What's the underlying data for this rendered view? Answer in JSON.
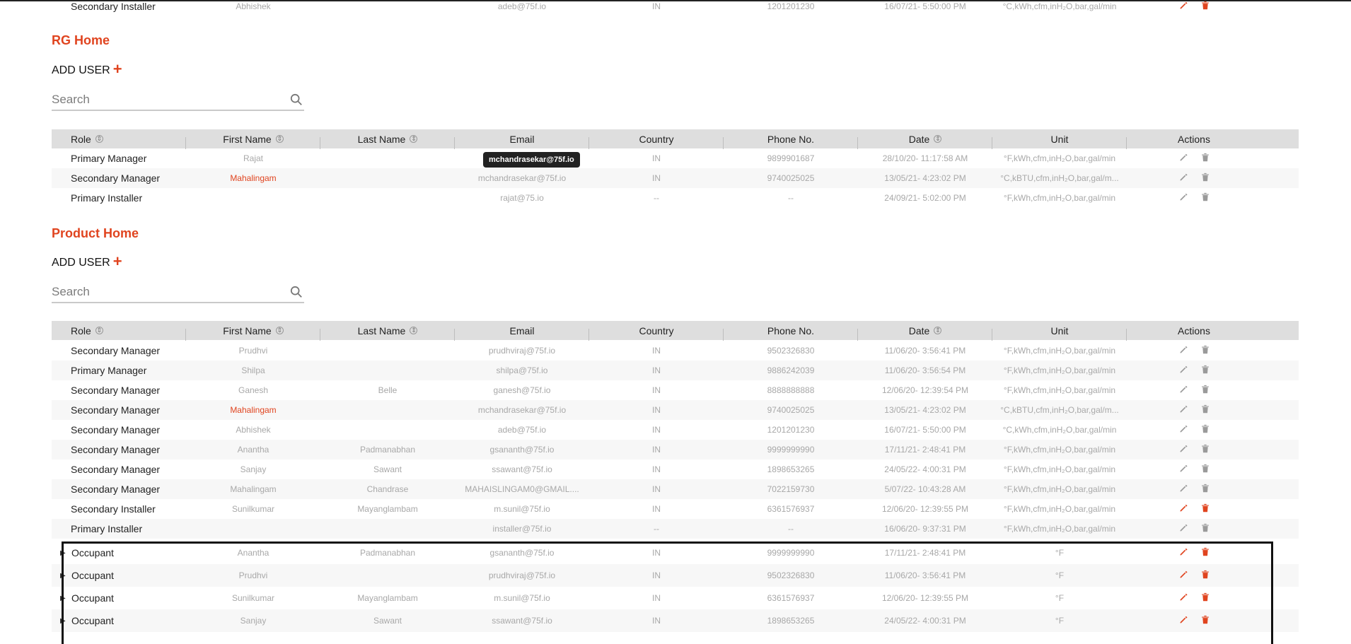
{
  "top_row": {
    "role": "Secondary Installer",
    "first_name": "Abhishek",
    "last_name": "",
    "email": "adeb@75f.io",
    "country": "IN",
    "phone": "1201201230",
    "date": "16/07/21- 5:50:00 PM",
    "unit": "°C,kWh,cfm,inH₂O,bar,gal/min",
    "active": true
  },
  "columns": {
    "role": "Role",
    "first_name": "First Name",
    "last_name": "Last Name",
    "email": "Email",
    "country": "Country",
    "phone": "Phone No.",
    "date": "Date",
    "unit": "Unit",
    "actions": "Actions"
  },
  "rg_home": {
    "title": "RG Home",
    "add_user": "ADD USER",
    "search_placeholder": "Search",
    "tooltip": "mchandrasekar@75f.io",
    "rows": [
      {
        "role": "Primary Manager",
        "first_name": "Rajat",
        "last_name": "",
        "email": "",
        "country": "IN",
        "phone": "9899901687",
        "date": "28/10/20- 11:17:58 AM",
        "unit": "°F,kWh,cfm,inH₂O,bar,gal/min"
      },
      {
        "role": "Secondary Manager",
        "first_name": "Mahalingam",
        "last_name": "",
        "email": "mchandrasekar@75f.io",
        "country": "IN",
        "phone": "9740025025",
        "date": "13/05/21- 4:23:02 PM",
        "unit": "°C,kBTU,cfm,inH₂O,bar,gal/m..."
      },
      {
        "role": "Primary Installer",
        "first_name": "",
        "last_name": "",
        "email": "rajat@75.io",
        "country": "--",
        "phone": "--",
        "date": "24/09/21- 5:02:00 PM",
        "unit": "°F,kWh,cfm,inH₂O,bar,gal/min"
      }
    ]
  },
  "product_home": {
    "title": "Product Home",
    "add_user": "ADD USER",
    "search_placeholder": "Search",
    "rows": [
      {
        "role": "Secondary Manager",
        "first_name": "Prudhvi",
        "last_name": "",
        "email": "prudhviraj@75f.io",
        "country": "IN",
        "phone": "9502326830",
        "date": "11/06/20- 3:56:41 PM",
        "unit": "°F,kWh,cfm,inH₂O,bar,gal/min"
      },
      {
        "role": "Primary Manager",
        "first_name": "Shilpa",
        "last_name": "",
        "email": "shilpa@75f.io",
        "country": "IN",
        "phone": "9886242039",
        "date": "11/06/20- 3:56:54 PM",
        "unit": "°F,kWh,cfm,inH₂O,bar,gal/min"
      },
      {
        "role": "Secondary Manager",
        "first_name": "Ganesh",
        "last_name": "Belle",
        "email": "ganesh@75f.io",
        "country": "IN",
        "phone": "8888888888",
        "date": "12/06/20- 12:39:54 PM",
        "unit": "°F,kWh,cfm,inH₂O,bar,gal/min"
      },
      {
        "role": "Secondary Manager",
        "first_name": "Mahalingam",
        "last_name": "",
        "email": "mchandrasekar@75f.io",
        "country": "IN",
        "phone": "9740025025",
        "date": "13/05/21- 4:23:02 PM",
        "unit": "°C,kBTU,cfm,inH₂O,bar,gal/m..."
      },
      {
        "role": "Secondary Manager",
        "first_name": "Abhishek",
        "last_name": "",
        "email": "adeb@75f.io",
        "country": "IN",
        "phone": "1201201230",
        "date": "16/07/21- 5:50:00 PM",
        "unit": "°C,kWh,cfm,inH₂O,bar,gal/min"
      },
      {
        "role": "Secondary Manager",
        "first_name": "Anantha",
        "last_name": "Padmanabhan",
        "email": "gsananth@75f.io",
        "country": "IN",
        "phone": "9999999990",
        "date": "17/11/21- 2:48:41 PM",
        "unit": "°F,kWh,cfm,inH₂O,bar,gal/min"
      },
      {
        "role": "Secondary Manager",
        "first_name": "Sanjay",
        "last_name": "Sawant",
        "email": "ssawant@75f.io",
        "country": "IN",
        "phone": "1898653265",
        "date": "24/05/22- 4:00:31 PM",
        "unit": "°F,kWh,cfm,inH₂O,bar,gal/min"
      },
      {
        "role": "Secondary Manager",
        "first_name": "Mahalingam",
        "last_name": "Chandrase",
        "email": "MAHAISLINGAM0@GMAIL....",
        "country": "IN",
        "phone": "7022159730",
        "date": "5/07/22- 10:43:28 AM",
        "unit": "°F,kWh,cfm,inH₂O,bar,gal/min"
      },
      {
        "role": "Secondary Installer",
        "first_name": "Sunilkumar",
        "last_name": "Mayanglambam",
        "email": "m.sunil@75f.io",
        "country": "IN",
        "phone": "6361576937",
        "date": "12/06/20- 12:39:55 PM",
        "unit": "°F,kWh,cfm,inH₂O,bar,gal/min"
      },
      {
        "role": "Primary Installer",
        "first_name": "",
        "last_name": "",
        "email": "installer@75f.io",
        "country": "--",
        "phone": "--",
        "date": "16/06/20- 9:37:31 PM",
        "unit": "°F,kWh,cfm,inH₂O,bar,gal/min"
      }
    ],
    "occupants": [
      {
        "role": "Occupant",
        "first_name": "Anantha",
        "last_name": "Padmanabhan",
        "email": "gsananth@75f.io",
        "country": "IN",
        "phone": "9999999990",
        "date": "17/11/21- 2:48:41 PM",
        "unit": "°F"
      },
      {
        "role": "Occupant",
        "first_name": "Prudhvi",
        "last_name": "",
        "email": "prudhviraj@75f.io",
        "country": "IN",
        "phone": "9502326830",
        "date": "11/06/20- 3:56:41 PM",
        "unit": "°F"
      },
      {
        "role": "Occupant",
        "first_name": "Sunilkumar",
        "last_name": "Mayanglambam",
        "email": "m.sunil@75f.io",
        "country": "IN",
        "phone": "6361576937",
        "date": "12/06/20- 12:39:55 PM",
        "unit": "°F"
      },
      {
        "role": "Occupant",
        "first_name": "Sanjay",
        "last_name": "Sawant",
        "email": "ssawant@75f.io",
        "country": "IN",
        "phone": "1898653265",
        "date": "24/05/22- 4:00:31 PM",
        "unit": "°F"
      }
    ]
  },
  "colors": {
    "accent": "#e0441f",
    "inactive_icon": "#9a9a9a"
  }
}
